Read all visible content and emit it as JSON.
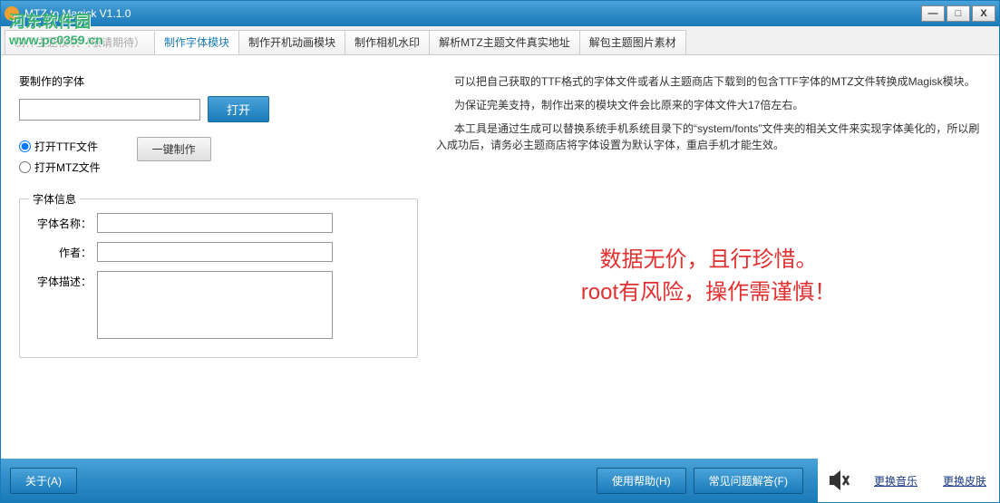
{
  "window": {
    "title": "MTZ to Magisk      V1.1.0"
  },
  "watermark": {
    "line1": "河东软件园",
    "line2": "www.pc0359.cn"
  },
  "tabs": [
    {
      "label": "制作主题模块（敬请期待）",
      "active": false,
      "faded": true
    },
    {
      "label": "制作字体模块",
      "active": true
    },
    {
      "label": "制作开机动画模块",
      "active": false
    },
    {
      "label": "制作相机水印",
      "active": false
    },
    {
      "label": "解析MTZ主题文件真实地址",
      "active": false
    },
    {
      "label": "解包主题图片素材",
      "active": false
    }
  ],
  "fileSection": {
    "label": "要制作的字体",
    "openBtn": "打开",
    "makeBtn": "一键制作",
    "radio1": "打开TTF文件",
    "radio2": "打开MTZ文件"
  },
  "fontInfo": {
    "title": "字体信息",
    "nameLabel": "字体名称：",
    "authorLabel": "作者：",
    "descLabel": "字体描述："
  },
  "description": {
    "p1": "      可以把自己获取的TTF格式的字体文件或者从主题商店下载到的包含TTF字体的MTZ文件转换成Magisk模块。",
    "p2": "      为保证完美支持，制作出来的模块文件会比原来的字体文件大17倍左右。",
    "p3": "      本工具是通过生成可以替换系统手机系统目录下的“system/fonts”文件夹的相关文件来实现字体美化的，所以刷入成功后，请务必主题商店将字体设置为默认字体，重启手机才能生效。"
  },
  "warning": {
    "line1": "数据无价，且行珍惜。",
    "line2": "root有风险，操作需谨慎！"
  },
  "footer": {
    "aboutBtn": "关于(A)",
    "helpBtn": "使用帮助(H)",
    "faqBtn": "常见问题解答(F)",
    "musicLink": "更换音乐",
    "skinLink": "更换皮肤"
  }
}
